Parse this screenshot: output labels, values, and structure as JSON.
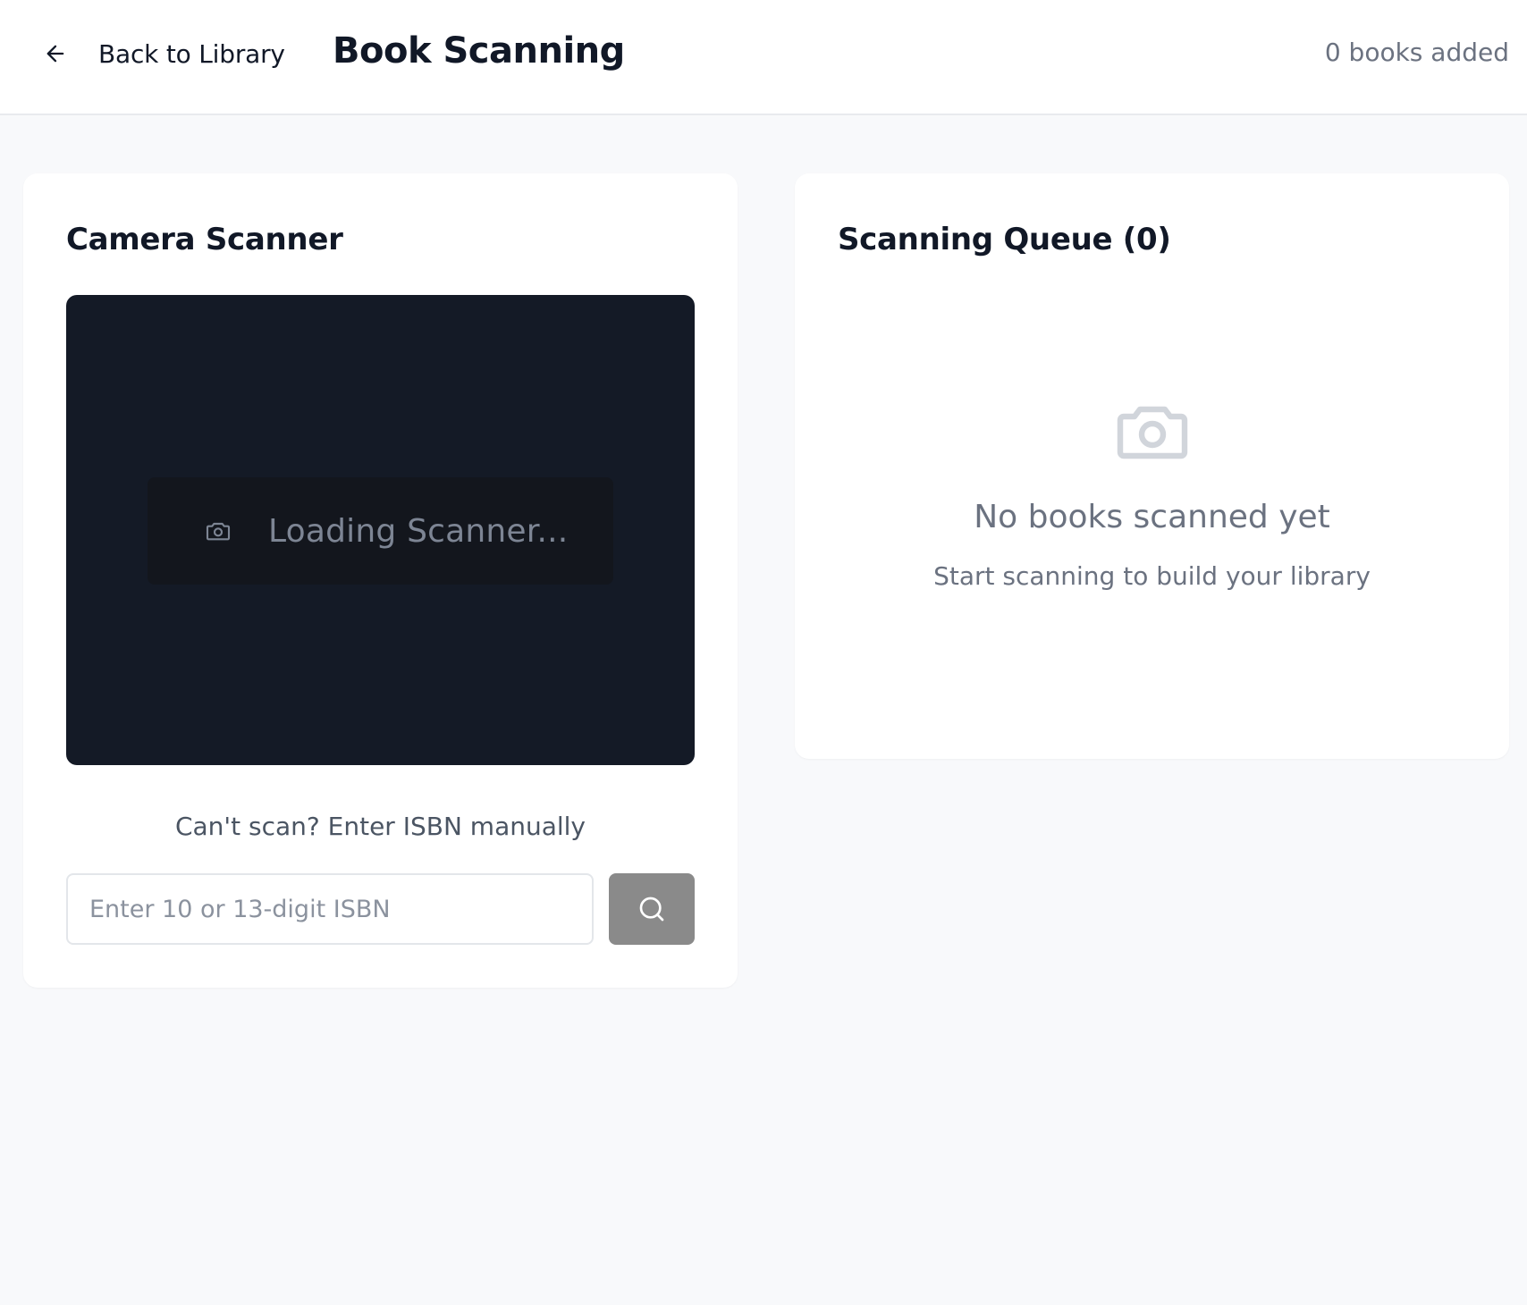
{
  "header": {
    "back_label": "Back to Library",
    "title": "Book Scanning",
    "books_added": "0 books added",
    "back_icon": "arrow-left-icon"
  },
  "scanner": {
    "title": "Camera Scanner",
    "loading_text": "Loading Scanner...",
    "loading_icon": "camera-icon",
    "manual_hint": "Can't scan? Enter ISBN manually",
    "isbn_placeholder": "Enter 10 or 13-digit ISBN",
    "isbn_value": "",
    "search_icon": "search-icon"
  },
  "queue": {
    "title": "Scanning Queue (0)",
    "empty_title": "No books scanned yet",
    "empty_subtitle": "Start scanning to build your library",
    "empty_icon": "camera-icon"
  },
  "colors": {
    "page_bg": "#f8f9fb",
    "card_bg": "#ffffff",
    "viewport_bg": "#141a26",
    "search_button_bg": "#8a8a8a",
    "muted_text": "#6b7280"
  }
}
